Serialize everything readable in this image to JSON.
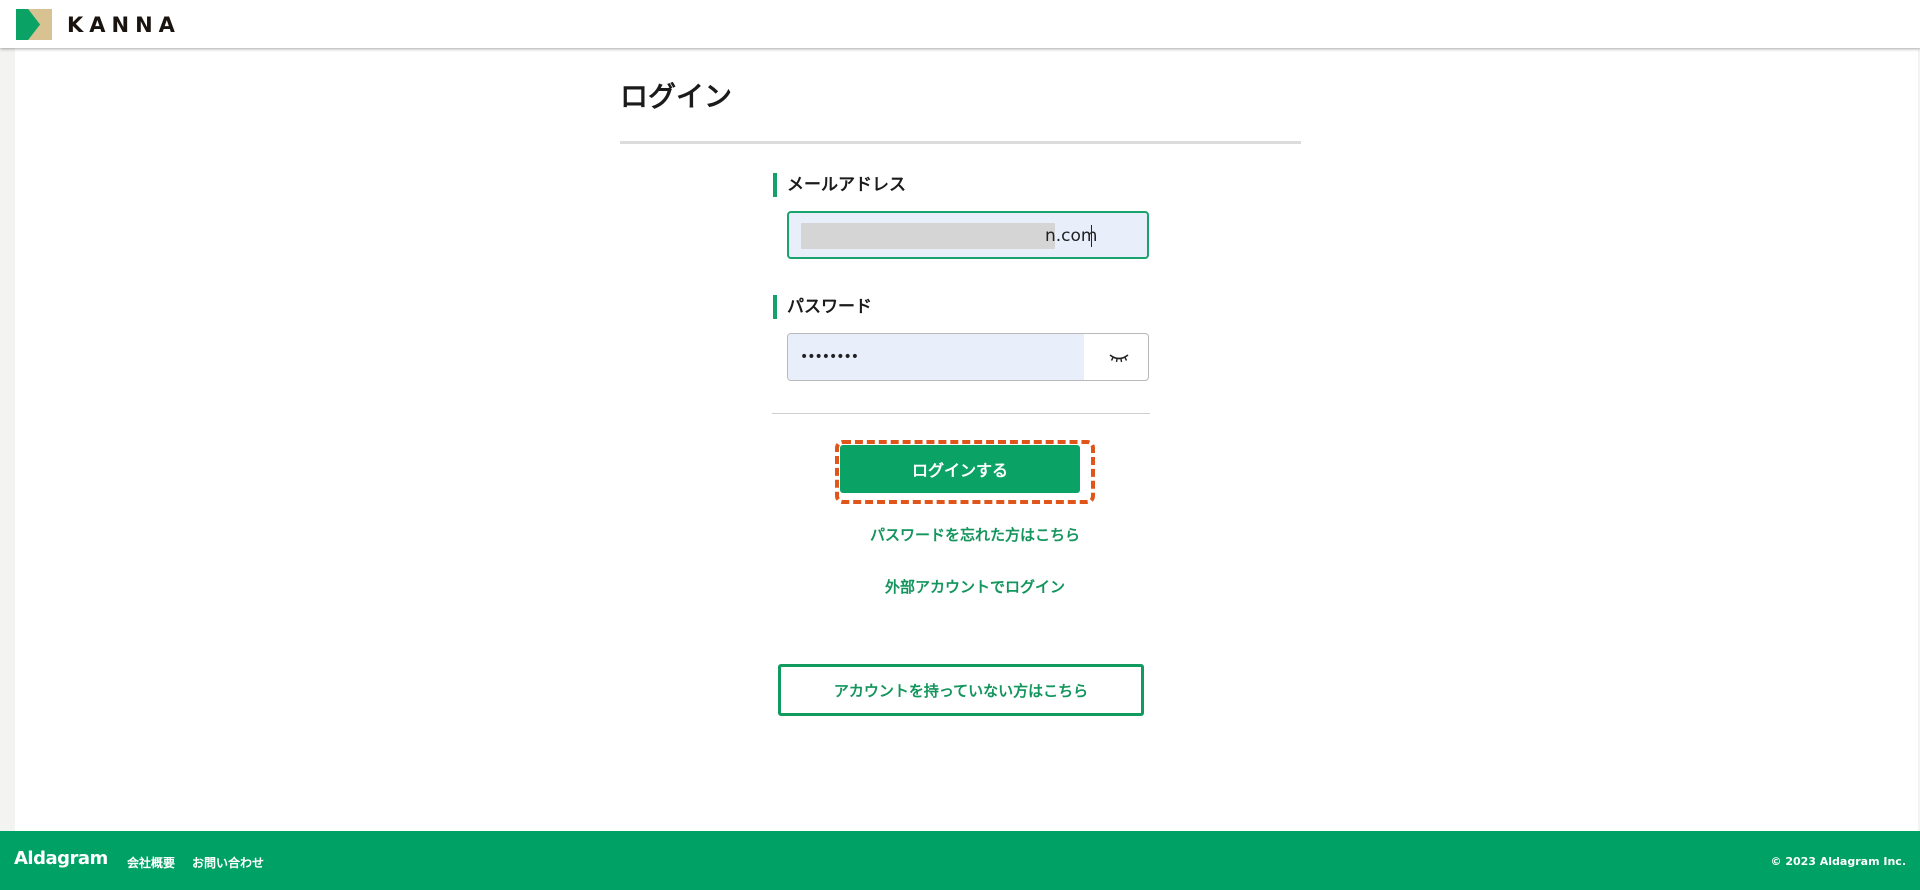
{
  "header": {
    "logo_text": "KANNA",
    "logo_colors": [
      "#0ba265",
      "#d8c291"
    ]
  },
  "login_form": {
    "title": "ログイン",
    "email_label": "メールアドレス",
    "email_value_visible": "n.com",
    "password_label": "パスワード",
    "password_value": "••••••••",
    "password_toggle_icon": "eye-closed-icon",
    "submit_label": "ログインする",
    "forgot_password_link": "パスワードを忘れた方はこちら",
    "external_login_link": "外部アカウントでログイン",
    "signup_button": "アカウントを持っていない方はこちら"
  },
  "footer": {
    "brand": "Aldagram",
    "links": [
      "会社概要",
      "お問い合わせ"
    ],
    "copyright": "© 2023 Aldagram Inc."
  },
  "colors": {
    "accent": "#0ba265",
    "highlight": "#e0561a",
    "input_fill": "#e8effb"
  }
}
